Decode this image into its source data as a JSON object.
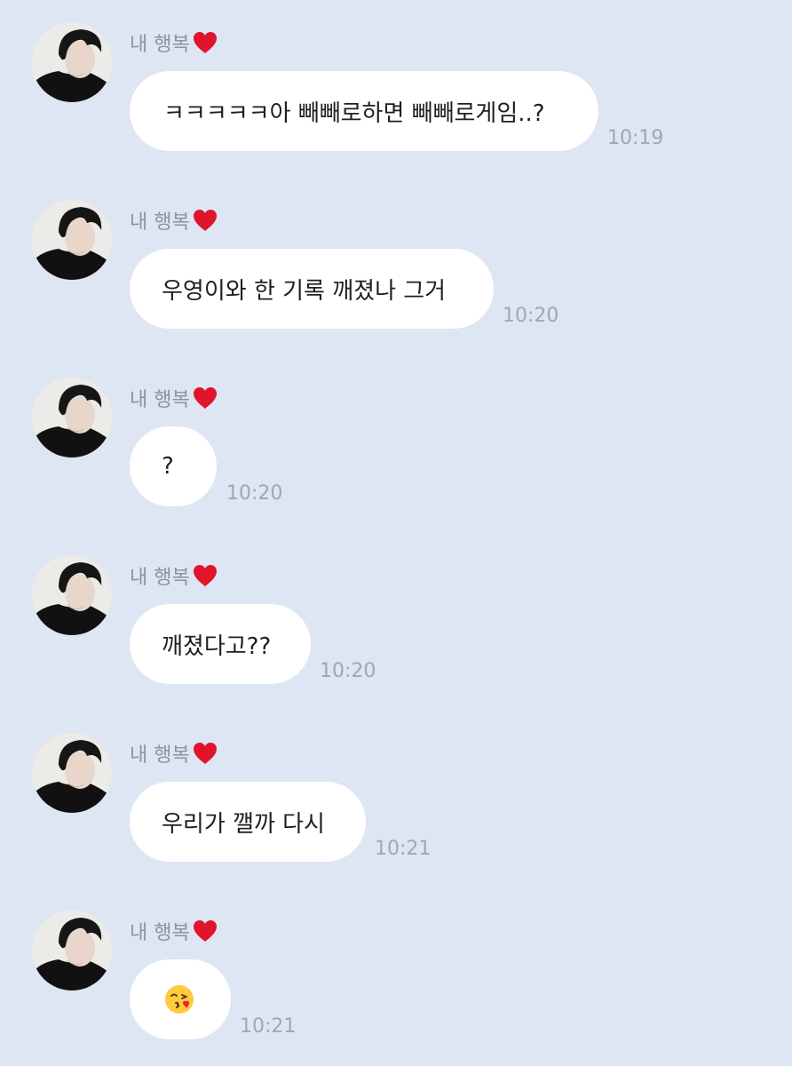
{
  "chat": {
    "sender_name": "내 행복",
    "sender_heart_icon": "red-heart-icon",
    "messages": [
      {
        "text": "ㅋㅋㅋㅋㅋ아 빼빼로하면 빼빼로게임..?",
        "time": "10:19"
      },
      {
        "text": "우영이와 한 기록 깨졌나 그거",
        "time": "10:20"
      },
      {
        "text": "?",
        "time": "10:20"
      },
      {
        "text": "깨졌다고??",
        "time": "10:20"
      },
      {
        "text": "우리가 깰까 다시",
        "time": "10:21"
      },
      {
        "text": "",
        "emoji": "face-blowing-a-kiss-emoji",
        "time": "10:21"
      }
    ]
  },
  "colors": {
    "background": "#dde6f2",
    "bubble": "#ffffff",
    "sender_text": "#8d939c",
    "time_text": "#9ea7b3",
    "message_text": "#1f1f1f",
    "heart": "#e0142b"
  }
}
